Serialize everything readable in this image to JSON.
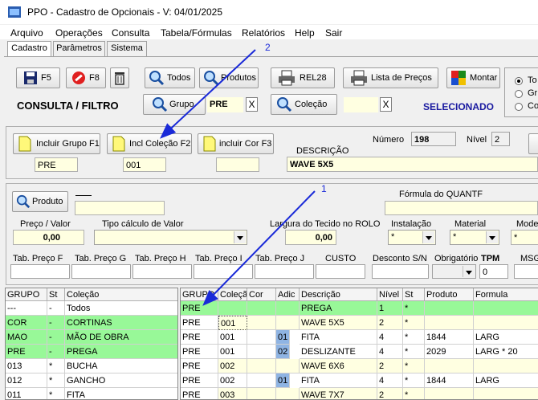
{
  "window": {
    "title": "PPO - Cadastro de Opcionais - V: 04/01/2025"
  },
  "menu": [
    "Arquivo",
    "Operações",
    "Consulta",
    "Tabela/Fórmulas",
    "Relatórios",
    "Help",
    "Sair"
  ],
  "tabs": [
    "Cadastro",
    "Parâmetros",
    "Sistema"
  ],
  "toolbar": {
    "f5": "F5",
    "f8": "F8",
    "todos": "Todos",
    "produtos": "Produtos",
    "rel28": "REL28",
    "lista_precos": "Lista de Preços",
    "montar": "Montar"
  },
  "consulta": {
    "title": "CONSULTA / FILTRO",
    "grupo_label": "Grupo",
    "grupo_value": "PRE",
    "colecao_label": "Coleção",
    "colecao_value": "",
    "clear": "X",
    "selecionado": "SELECIONADO"
  },
  "radios": [
    "To",
    "Gr",
    "Co"
  ],
  "annotations": {
    "arrow1": "1",
    "arrow2": "2"
  },
  "includes": {
    "grupo_btn": "Incluir Grupo F1",
    "colecao_btn": "Incl Coleção F2",
    "cor_btn": "incluir Cor F3",
    "grupo_value": "PRE",
    "colecao_value": "001",
    "cor_value": "",
    "numero_label": "Número",
    "numero_value": "198",
    "nivel_label": "Nível",
    "nivel_value": "2",
    "descricao_label": "DESCRIÇÃO",
    "descricao_value": "WAVE 5X5"
  },
  "form": {
    "produto_btn": "Produto",
    "formula_label": "Fórmula do QUANTF",
    "preco_label": "Preço / Valor",
    "preco_value": "0,00",
    "tipo_calculo_label": "Tipo cálculo de Valor",
    "largura_label": "Largura do Tecido no ROLO",
    "largura_value": "0,00",
    "instalacao_label": "Instalação",
    "instalacao_value": "*",
    "material_label": "Material",
    "material_value": "*",
    "modelo_label": "Mode",
    "modelo_value": "*",
    "tab_f": "Tab. Preço F",
    "tab_g": "Tab. Preço G",
    "tab_h": "Tab. Preço H",
    "tab_i": "Tab. Preço I",
    "tab_j": "Tab. Preço J",
    "custo": "CUSTO",
    "desconto": "Desconto S/N",
    "obrigatorio": "Obrigatório",
    "tpm_label": "TPM",
    "tpm_value": "0",
    "msg": "MSG"
  },
  "left_table": {
    "headers": [
      "GRUPO",
      "St",
      "Coleção"
    ],
    "rows": [
      [
        "---",
        "-",
        "Todos"
      ],
      [
        "COR",
        "-",
        "CORTINAS"
      ],
      [
        "MAO",
        "-",
        "MÃO DE OBRA"
      ],
      [
        "PRE",
        "-",
        "PREGA"
      ],
      [
        "013",
        "*",
        "BUCHA"
      ],
      [
        "012",
        "*",
        "GANCHO"
      ],
      [
        "011",
        "*",
        "FITA"
      ]
    ]
  },
  "right_table": {
    "headers": [
      "GRUPO",
      "Coleção",
      "Cor",
      "Adic",
      "Descrição",
      "Nível",
      "St",
      "Produto",
      "Formula"
    ],
    "rows": [
      [
        "PRE",
        "",
        "",
        "",
        "PREGA",
        "1",
        "*",
        "",
        ""
      ],
      [
        "PRE",
        "001",
        "",
        "",
        "WAVE 5X5",
        "2",
        "*",
        "",
        ""
      ],
      [
        "PRE",
        "001",
        "",
        "01",
        "FITA",
        "4",
        "*",
        "1844",
        "LARG"
      ],
      [
        "PRE",
        "001",
        "",
        "02",
        "DESLIZANTE",
        "4",
        "*",
        "2029",
        "LARG * 20"
      ],
      [
        "PRE",
        "002",
        "",
        "",
        "WAVE 6X6",
        "2",
        "*",
        "",
        ""
      ],
      [
        "PRE",
        "002",
        "",
        "01",
        "FITA",
        "4",
        "*",
        "1844",
        "LARG"
      ],
      [
        "PRE",
        "003",
        "",
        "",
        "WAVE 7X7",
        "2",
        "*",
        "",
        ""
      ]
    ]
  }
}
